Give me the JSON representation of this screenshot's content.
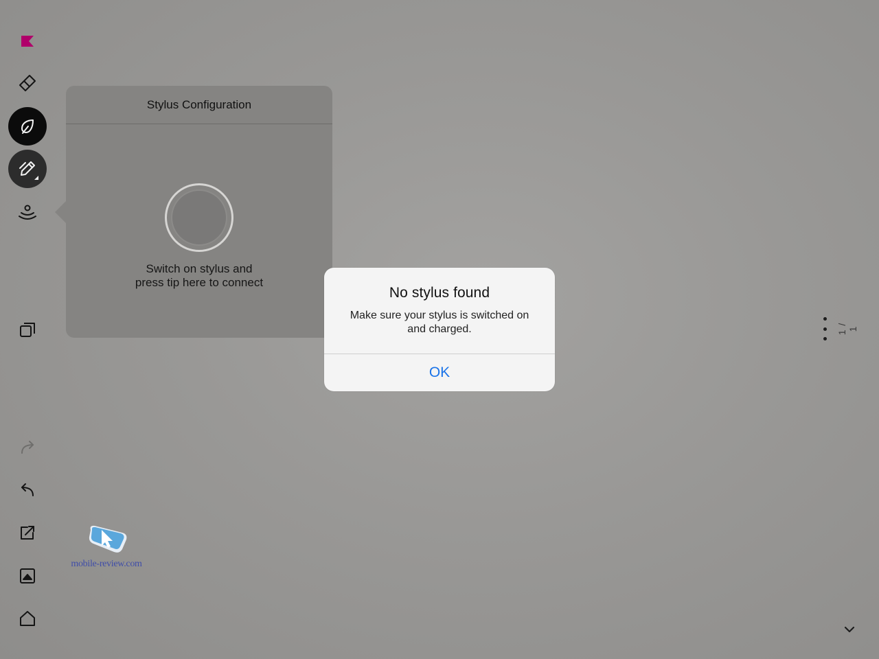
{
  "theme": {
    "accent": "#1a73e8",
    "brand_flag": "#b0006a",
    "background": "#9b9a98"
  },
  "sidebar": {
    "items": [
      {
        "name": "brand-flag-icon"
      },
      {
        "name": "eraser-icon"
      },
      {
        "name": "ink-drop-icon",
        "state": "active"
      },
      {
        "name": "pen-edit-icon",
        "state": "active"
      },
      {
        "name": "stylus-connect-icon"
      },
      {
        "name": "pages-icon"
      },
      {
        "name": "redo-icon",
        "state": "disabled"
      },
      {
        "name": "undo-icon"
      },
      {
        "name": "share-icon"
      },
      {
        "name": "image-icon"
      },
      {
        "name": "home-icon"
      }
    ]
  },
  "stylus_popover": {
    "title": "Stylus Configuration",
    "message": "Switch on stylus and press tip here to connect"
  },
  "alert": {
    "title": "No stylus found",
    "message": "Make sure your stylus is switched on and charged.",
    "ok_label": "OK"
  },
  "page_counter": "1 / 1",
  "watermark": {
    "text": "mobile-review.com"
  }
}
